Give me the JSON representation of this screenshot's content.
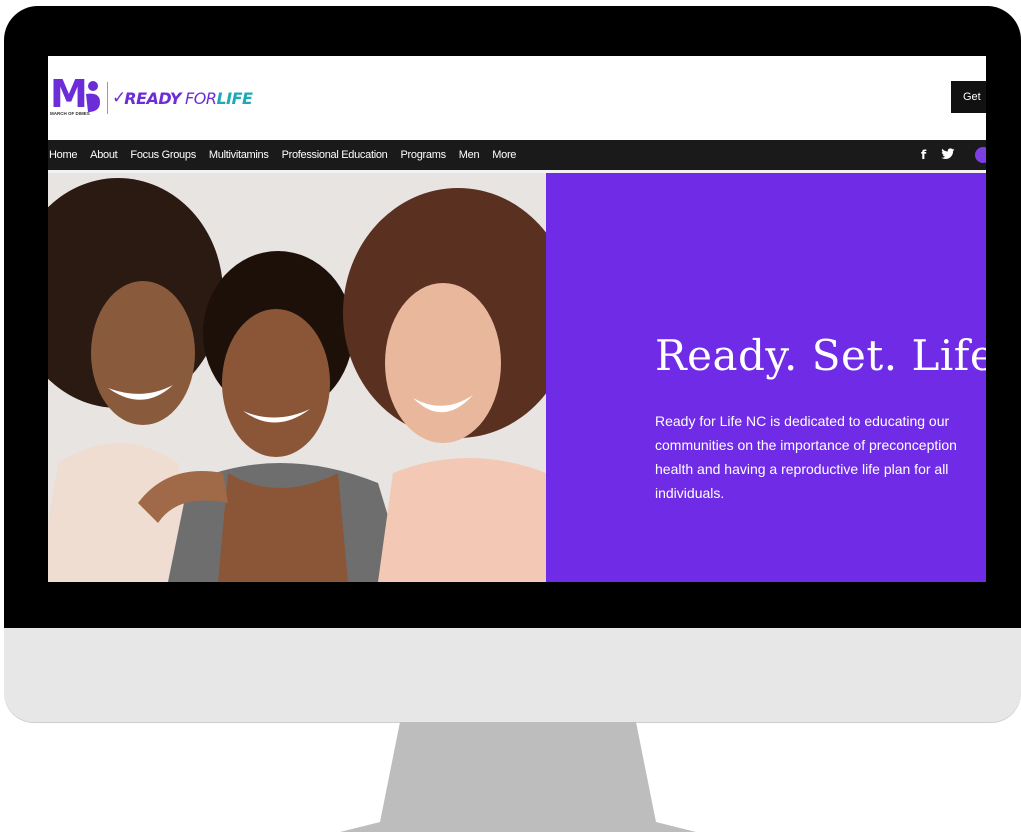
{
  "brand": {
    "mod_mark": "M",
    "mod_name": "MARCH OF DIMES",
    "check": "✓",
    "ready": "READY",
    "for": "FOR",
    "life": "LIFE",
    "purple": "#6c2dd9",
    "teal": "#1ea9b7"
  },
  "header": {
    "cta_label": "Get"
  },
  "nav": {
    "items": [
      {
        "label": "Home"
      },
      {
        "label": "About"
      },
      {
        "label": "Focus Groups"
      },
      {
        "label": "Multivitamins"
      },
      {
        "label": "Professional Education"
      },
      {
        "label": "Programs"
      },
      {
        "label": "Men"
      },
      {
        "label": "More"
      }
    ],
    "social": {
      "facebook": "f",
      "twitter_icon": "twitter-icon",
      "user_icon": "user-avatar-icon"
    }
  },
  "hero": {
    "title": "Ready. Set. Life!",
    "body": "Ready for Life NC is dedicated to educating our communities on the importance of preconception health and having a reproductive life plan for all individuals.",
    "panel_color": "#6f2be6"
  }
}
